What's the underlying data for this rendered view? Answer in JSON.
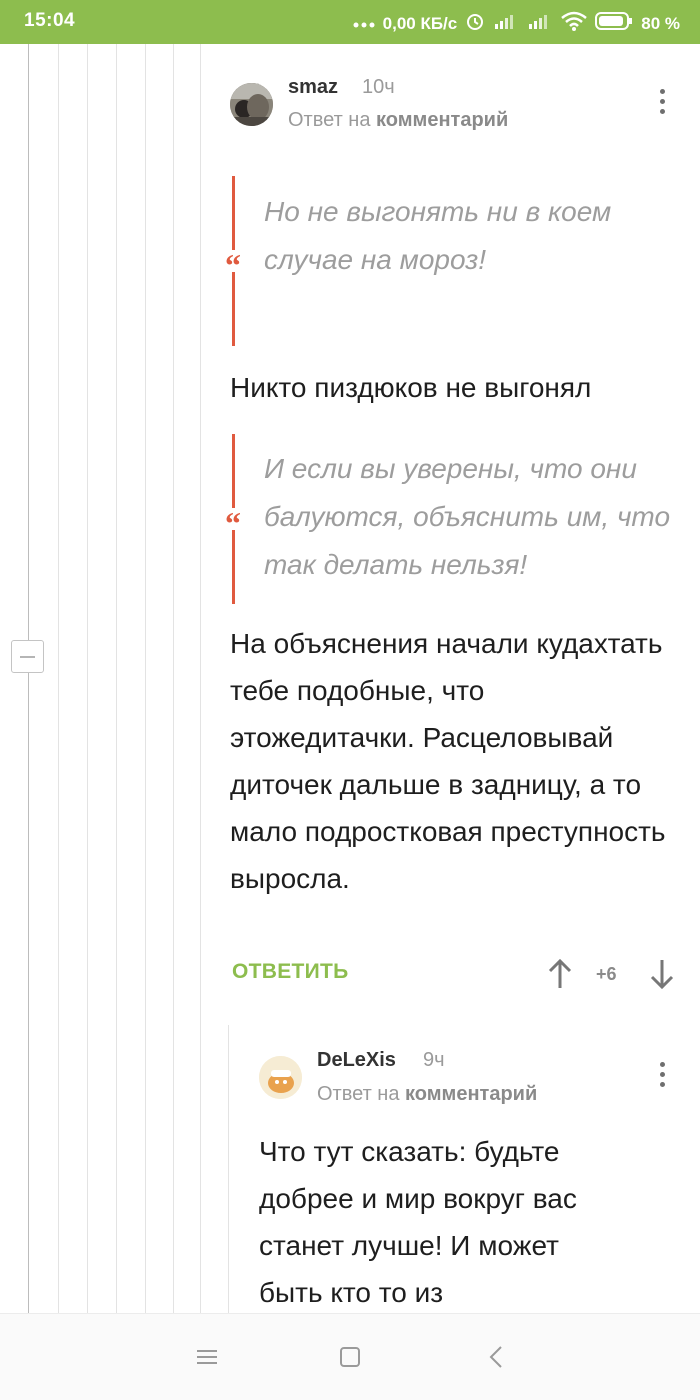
{
  "status_bar": {
    "time": "15:04",
    "network_speed": "0,00 КБ/с",
    "battery": "80 %"
  },
  "comments": [
    {
      "author": "smaz",
      "time": "10ч",
      "reply_prefix": "Ответ на",
      "reply_link": "комментарий",
      "quote1": "Но не выгонять ни в коем случае на мороз!",
      "text1": "Никто пиздюков не выгонял",
      "quote2": " И если вы уверены, что они балуются, объяснить им, что так делать нельзя!",
      "text2": "На объяснения начали кудахтать тебе подобные, что этожедитачки. Расцеловывай диточек дальше в задницу, а то мало подростковая преступность выросла.",
      "reply_label": "ОТВЕТИТЬ",
      "score": "+6"
    },
    {
      "author": "DeLeXis",
      "time": "9ч",
      "reply_prefix": "Ответ на",
      "reply_link": "комментарий",
      "text": "Что тут сказать: будьте добрее и мир вокруг вас станет лучше! И может быть кто то из"
    }
  ],
  "icons": [
    "dots-icon",
    "wifi-icon",
    "signal-icon",
    "alarm-icon",
    "battery-icon",
    "arrow-up-icon",
    "arrow-down-icon",
    "menu-icon",
    "home-icon",
    "back-icon"
  ],
  "colors": {
    "status_bar": "#8dbd4e",
    "accent": "#8dbd4e",
    "quote_bar": "#e05a3f",
    "muted_text": "#9d9d9d"
  }
}
